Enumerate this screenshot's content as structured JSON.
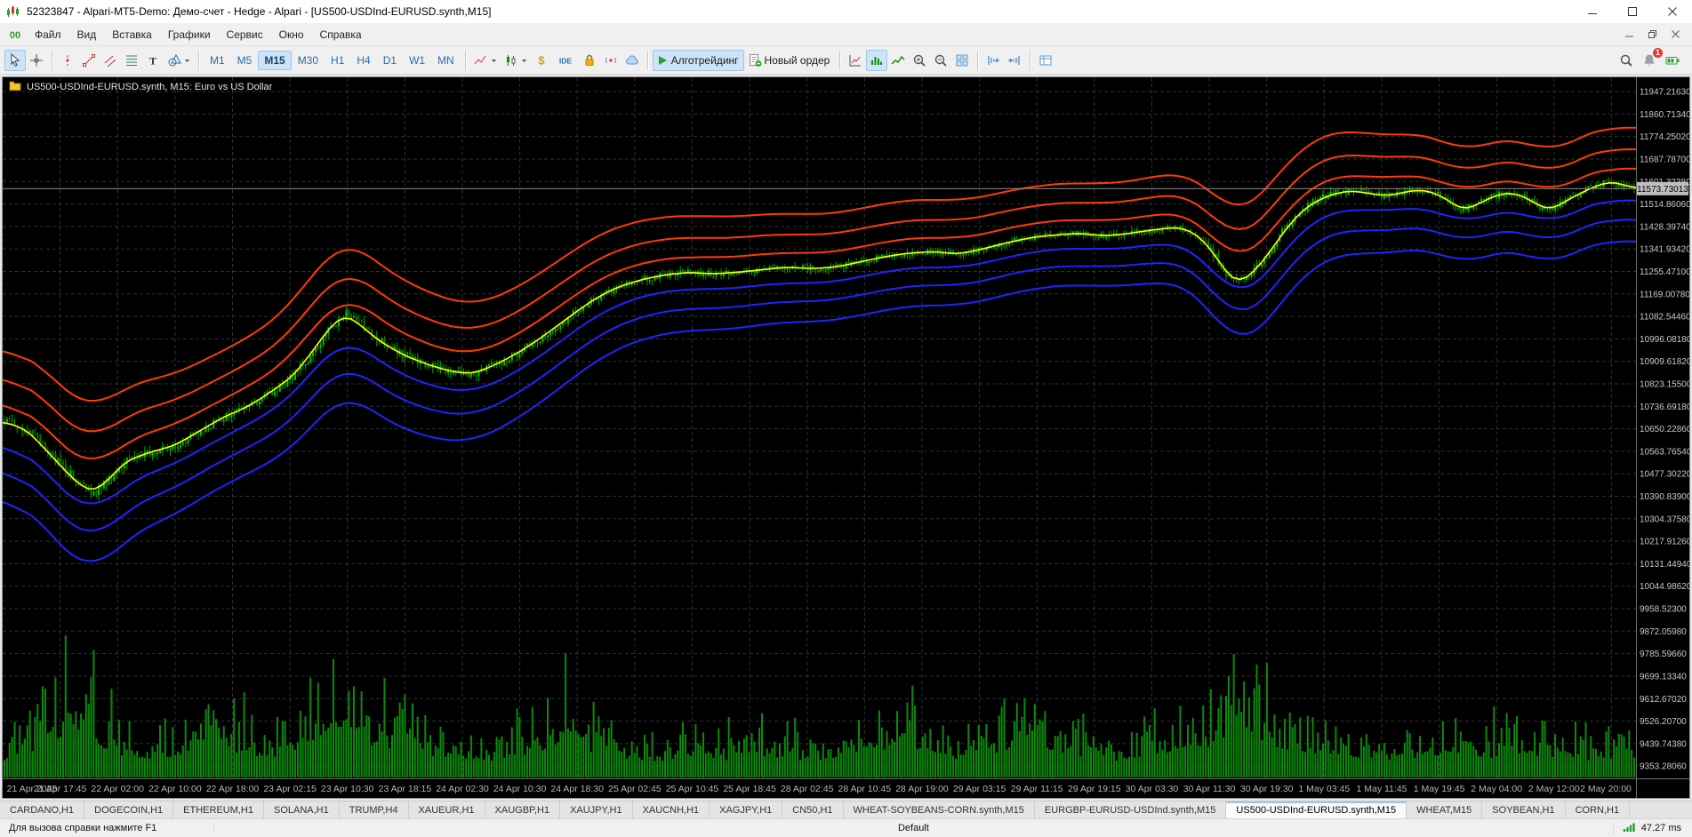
{
  "window": {
    "title": "52323847 - Alpari-MT5-Demo: Демо-счет - Hedge - Alpari - [US500-USDInd-EURUSD.synth,M15]"
  },
  "menu": {
    "items": [
      "Файл",
      "Вид",
      "Вставка",
      "Графики",
      "Сервис",
      "Окно",
      "Справка"
    ]
  },
  "toolbar": {
    "groups": [
      {
        "items": [
          {
            "icon": "cursor",
            "name": "cursor-tool",
            "active": true
          },
          {
            "icon": "crosshair",
            "name": "crosshair-tool"
          }
        ]
      },
      {
        "items": [
          {
            "icon": "vline",
            "name": "vertical-line-tool"
          },
          {
            "icon": "trendline",
            "name": "trendline-tool"
          },
          {
            "icon": "channel",
            "name": "equidistant-channel-tool"
          },
          {
            "icon": "fibonacci",
            "name": "fibonacci-tool"
          },
          {
            "icon": "text",
            "name": "text-tool"
          },
          {
            "icon": "shapes",
            "name": "shapes-tool",
            "caret": true
          }
        ]
      },
      {
        "timeframes": [
          "M1",
          "M5",
          "M15",
          "M30",
          "H1",
          "H4",
          "D1",
          "W1",
          "MN"
        ],
        "active": "M15"
      },
      {
        "items": [
          {
            "icon": "linechart",
            "name": "line-chart-type",
            "caret": true
          },
          {
            "icon": "candles",
            "name": "candle-chart-type",
            "caret": true
          },
          {
            "icon": "dollar",
            "name": "market-watch-toggle"
          },
          {
            "icon": "ide",
            "name": "metaeditor-ide-button"
          },
          {
            "icon": "lock",
            "name": "lock-toggle"
          },
          {
            "icon": "signals",
            "name": "signals-service-button"
          },
          {
            "icon": "cloud",
            "name": "cloud-service-button"
          }
        ]
      },
      {
        "items": [
          {
            "icon": "play",
            "name": "algo-trading-button",
            "label": "Алготрейдинг",
            "active": true
          },
          {
            "icon": "neworder",
            "name": "new-order-button",
            "label": "Новый ордер"
          }
        ]
      },
      {
        "items": [
          {
            "icon": "tickchart",
            "name": "tick-chart-toggle"
          },
          {
            "icon": "volumes",
            "name": "volumes-toggle",
            "active": true
          },
          {
            "icon": "depth",
            "name": "depth-of-market-toggle"
          },
          {
            "icon": "zoomin",
            "name": "zoom-in-button"
          },
          {
            "icon": "zoomout",
            "name": "zoom-out-button"
          },
          {
            "icon": "gridwin",
            "name": "tile-windows-button"
          }
        ]
      },
      {
        "items": [
          {
            "icon": "panelleft",
            "name": "arrange-panel-left-button"
          },
          {
            "icon": "panelright",
            "name": "arrange-panel-right-button"
          }
        ]
      },
      {
        "items": [
          {
            "icon": "datawin",
            "name": "data-window-toggle"
          }
        ]
      }
    ],
    "right": [
      {
        "icon": "search",
        "name": "search-button"
      },
      {
        "icon": "bell",
        "name": "notifications-button",
        "badge": "1"
      },
      {
        "icon": "battery",
        "name": "connection-power-indicator"
      }
    ]
  },
  "chart": {
    "symbol_label": "US500-USDInd-EURUSD.synth, M15:  Euro vs US Dollar",
    "current_price_label": "11573.73013"
  },
  "bottom_tabs": {
    "tabs": [
      "CARDANO,H1",
      "DOGECOIN,H1",
      "ETHEREUM,H1",
      "SOLANA,H1",
      "TRUMP,H4",
      "XAUEUR,H1",
      "XAUGBP,H1",
      "XAUJPY,H1",
      "XAUCNH,H1",
      "XAGJPY,H1",
      "CN50,H1",
      "WHEAT-SOYBEANS-CORN.synth,M15",
      "EURGBP-EURUSD-USDInd.synth,M15",
      "US500-USDInd-EURUSD.synth,M15",
      "WHEAT,M15",
      "SOYBEAN,H1",
      "CORN,H1"
    ],
    "active": "US500-USDInd-EURUSD.synth,M15"
  },
  "status_bar": {
    "help": "Для вызова справки нажмите F1",
    "profile": "Default",
    "latency": "47.27 ms"
  },
  "chart_data": {
    "type": "candlestick",
    "title": "US500-USDInd-EURUSD.synth, M15: Euro vs US Dollar",
    "symbol": "US500-USDInd-EURUSD.synth",
    "timeframe": "M15",
    "overlays": [
      "three upper envelope bands (orange)",
      "midline (yellow)",
      "three lower envelope bands (blue)",
      "volume (green)"
    ],
    "ylim": [
      9306,
      12002
    ],
    "current_price": 11573.73013,
    "price_ticks": [
      "11947.21630",
      "11860.71340",
      "11774.25020",
      "11687.78700",
      "11601.32380",
      "11514.86060",
      "11428.39740",
      "11341.93420",
      "11255.47100",
      "11169.00780",
      "11082.54460",
      "10996.08180",
      "10909.61820",
      "10823.15500",
      "10736.69180",
      "10650.22860",
      "10563.76540",
      "10477.30220",
      "10390.83900",
      "10304.37580",
      "10217.91260",
      "10131.44940",
      "10044.98620",
      "9958.52300",
      "9872.05980",
      "9785.59660",
      "9699.13340",
      "9612.67020",
      "9526.20700",
      "9439.74380",
      "9353.28060"
    ],
    "time_ticks": [
      "21 Apr 2025",
      "21 Apr 17:45",
      "22 Apr 02:00",
      "22 Apr 10:00",
      "22 Apr 18:00",
      "23 Apr 02:15",
      "23 Apr 10:30",
      "23 Apr 18:15",
      "24 Apr 02:30",
      "24 Apr 10:30",
      "24 Apr 18:30",
      "25 Apr 02:45",
      "25 Apr 10:45",
      "25 Apr 18:45",
      "28 Apr 02:45",
      "28 Apr 10:45",
      "28 Apr 19:00",
      "29 Apr 03:15",
      "29 Apr 11:15",
      "29 Apr 19:15",
      "30 Apr 03:30",
      "30 Apr 11:30",
      "30 Apr 19:30",
      "1 May 03:45",
      "1 May 11:45",
      "1 May 19:45",
      "2 May 04:00",
      "2 May 12:00",
      "2 May 20:00"
    ],
    "midline": [
      [
        0,
        10680
      ],
      [
        0.015,
        10645
      ],
      [
        0.03,
        10545
      ],
      [
        0.045,
        10445
      ],
      [
        0.055,
        10405
      ],
      [
        0.065,
        10455
      ],
      [
        0.075,
        10525
      ],
      [
        0.09,
        10560
      ],
      [
        0.105,
        10585
      ],
      [
        0.12,
        10640
      ],
      [
        0.135,
        10695
      ],
      [
        0.15,
        10735
      ],
      [
        0.165,
        10795
      ],
      [
        0.178,
        10855
      ],
      [
        0.19,
        10950
      ],
      [
        0.2,
        11040
      ],
      [
        0.21,
        11090
      ],
      [
        0.218,
        11055
      ],
      [
        0.23,
        10990
      ],
      [
        0.245,
        10935
      ],
      [
        0.26,
        10898
      ],
      [
        0.275,
        10870
      ],
      [
        0.288,
        10862
      ],
      [
        0.3,
        10892
      ],
      [
        0.315,
        10940
      ],
      [
        0.33,
        11002
      ],
      [
        0.345,
        11072
      ],
      [
        0.36,
        11140
      ],
      [
        0.375,
        11192
      ],
      [
        0.39,
        11222
      ],
      [
        0.405,
        11242
      ],
      [
        0.42,
        11252
      ],
      [
        0.435,
        11246
      ],
      [
        0.45,
        11252
      ],
      [
        0.465,
        11262
      ],
      [
        0.48,
        11272
      ],
      [
        0.495,
        11266
      ],
      [
        0.51,
        11272
      ],
      [
        0.525,
        11292
      ],
      [
        0.54,
        11312
      ],
      [
        0.555,
        11326
      ],
      [
        0.57,
        11332
      ],
      [
        0.585,
        11322
      ],
      [
        0.6,
        11342
      ],
      [
        0.615,
        11366
      ],
      [
        0.63,
        11386
      ],
      [
        0.645,
        11396
      ],
      [
        0.66,
        11402
      ],
      [
        0.675,
        11392
      ],
      [
        0.69,
        11402
      ],
      [
        0.705,
        11416
      ],
      [
        0.72,
        11426
      ],
      [
        0.731,
        11400
      ],
      [
        0.741,
        11330
      ],
      [
        0.75,
        11242
      ],
      [
        0.757,
        11212
      ],
      [
        0.766,
        11252
      ],
      [
        0.776,
        11332
      ],
      [
        0.786,
        11422
      ],
      [
        0.796,
        11492
      ],
      [
        0.806,
        11532
      ],
      [
        0.816,
        11556
      ],
      [
        0.826,
        11566
      ],
      [
        0.836,
        11556
      ],
      [
        0.846,
        11546
      ],
      [
        0.856,
        11556
      ],
      [
        0.866,
        11570
      ],
      [
        0.876,
        11560
      ],
      [
        0.886,
        11526
      ],
      [
        0.893,
        11492
      ],
      [
        0.901,
        11506
      ],
      [
        0.911,
        11540
      ],
      [
        0.921,
        11560
      ],
      [
        0.931,
        11546
      ],
      [
        0.941,
        11506
      ],
      [
        0.948,
        11492
      ],
      [
        0.956,
        11522
      ],
      [
        0.966,
        11556
      ],
      [
        0.976,
        11586
      ],
      [
        0.986,
        11602
      ],
      [
        0.993,
        11586
      ],
      [
        1,
        11574
      ]
    ],
    "band_width": [
      [
        0,
        280
      ],
      [
        0.05,
        320
      ],
      [
        0.1,
        270
      ],
      [
        0.15,
        255
      ],
      [
        0.2,
        300
      ],
      [
        0.25,
        285
      ],
      [
        0.3,
        255
      ],
      [
        0.35,
        245
      ],
      [
        0.4,
        225
      ],
      [
        0.45,
        215
      ],
      [
        0.5,
        205
      ],
      [
        0.55,
        205
      ],
      [
        0.6,
        200
      ],
      [
        0.65,
        195
      ],
      [
        0.7,
        200
      ],
      [
        0.74,
        225
      ],
      [
        0.76,
        265
      ],
      [
        0.8,
        245
      ],
      [
        0.85,
        225
      ],
      [
        0.9,
        215
      ],
      [
        0.95,
        215
      ],
      [
        1,
        220
      ]
    ],
    "band_fractions": [
      1.0,
      0.62,
      0.28
    ],
    "volume_profile": [
      [
        0,
        0.3
      ],
      [
        0.02,
        0.55
      ],
      [
        0.04,
        0.75
      ],
      [
        0.05,
        0.95
      ],
      [
        0.06,
        0.55
      ],
      [
        0.08,
        0.35
      ],
      [
        0.1,
        0.38
      ],
      [
        0.12,
        0.55
      ],
      [
        0.13,
        0.85
      ],
      [
        0.14,
        0.5
      ],
      [
        0.16,
        0.35
      ],
      [
        0.18,
        0.55
      ],
      [
        0.2,
        0.9
      ],
      [
        0.21,
        1
      ],
      [
        0.22,
        0.65
      ],
      [
        0.24,
        0.5
      ],
      [
        0.26,
        0.42
      ],
      [
        0.28,
        0.38
      ],
      [
        0.3,
        0.32
      ],
      [
        0.32,
        0.45
      ],
      [
        0.34,
        0.6
      ],
      [
        0.35,
        0.85
      ],
      [
        0.36,
        0.5
      ],
      [
        0.38,
        0.36
      ],
      [
        0.4,
        0.3
      ],
      [
        0.42,
        0.36
      ],
      [
        0.44,
        0.32
      ],
      [
        0.46,
        0.42
      ],
      [
        0.48,
        0.36
      ],
      [
        0.5,
        0.32
      ],
      [
        0.52,
        0.42
      ],
      [
        0.54,
        0.55
      ],
      [
        0.55,
        0.78
      ],
      [
        0.56,
        0.46
      ],
      [
        0.58,
        0.32
      ],
      [
        0.6,
        0.42
      ],
      [
        0.62,
        0.56
      ],
      [
        0.63,
        0.82
      ],
      [
        0.64,
        0.5
      ],
      [
        0.66,
        0.36
      ],
      [
        0.68,
        0.32
      ],
      [
        0.7,
        0.42
      ],
      [
        0.72,
        0.5
      ],
      [
        0.74,
        0.6
      ],
      [
        0.75,
        0.78
      ],
      [
        0.76,
        0.88
      ],
      [
        0.78,
        0.52
      ],
      [
        0.8,
        0.46
      ],
      [
        0.82,
        0.4
      ],
      [
        0.84,
        0.36
      ],
      [
        0.86,
        0.32
      ],
      [
        0.88,
        0.36
      ],
      [
        0.9,
        0.42
      ],
      [
        0.92,
        0.36
      ],
      [
        0.94,
        0.32
      ],
      [
        0.96,
        0.36
      ],
      [
        0.98,
        0.3
      ],
      [
        1,
        0.34
      ]
    ],
    "colors": {
      "background": "#000000",
      "grid": "#303030",
      "candle_up": "#00c300",
      "candle_down": "#008000",
      "wick": "#00a000",
      "upper_bands": "#ff3c00",
      "lower_bands": "#2222ff",
      "midline": "#ffff00",
      "volume": "#0b8a0b",
      "bid_line": "#909090",
      "axis_text": "#c9c9c9",
      "price_tag_bg": "#c0c0c0"
    },
    "legend_position": "none",
    "grid": true
  }
}
